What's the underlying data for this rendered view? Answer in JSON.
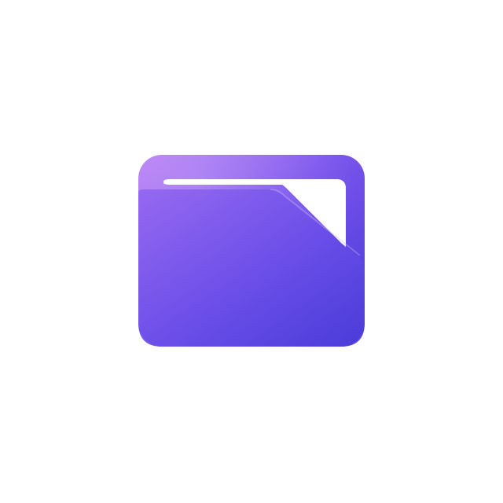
{
  "icon": {
    "name": "folder-icon",
    "colors": {
      "top_left": "#b77cf5",
      "mid": "#7a55ec",
      "bottom_right": "#4438d6",
      "slot": "#ffffff"
    }
  }
}
